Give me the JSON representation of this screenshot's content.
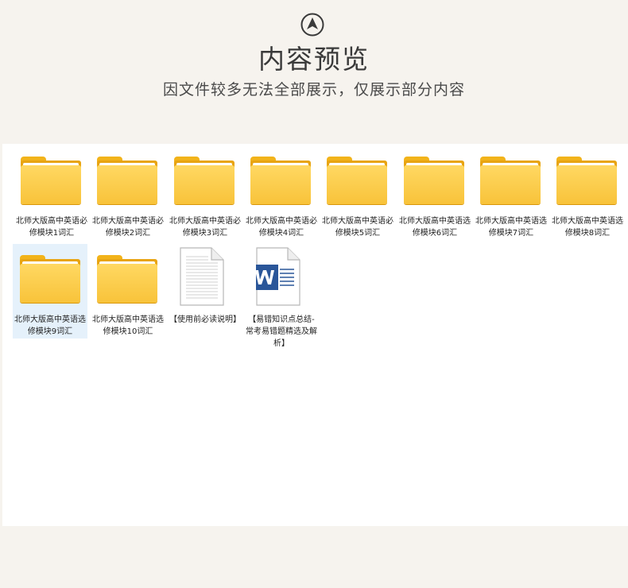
{
  "header": {
    "title": "内容预览",
    "subtitle": "因文件较多无法全部展示，仅展示部分内容"
  },
  "files": [
    {
      "name": "北师大版高中英语必修模块1词汇",
      "type": "folder"
    },
    {
      "name": "北师大版高中英语必修模块2词汇",
      "type": "folder"
    },
    {
      "name": "北师大版高中英语必修模块3词汇",
      "type": "folder"
    },
    {
      "name": "北师大版高中英语必修模块4词汇",
      "type": "folder"
    },
    {
      "name": "北师大版高中英语必修模块5词汇",
      "type": "folder"
    },
    {
      "name": "北师大版高中英语选修模块6词汇",
      "type": "folder"
    },
    {
      "name": "北师大版高中英语选修模块7词汇",
      "type": "folder"
    },
    {
      "name": "北师大版高中英语选修模块8词汇",
      "type": "folder"
    },
    {
      "name": "北师大版高中英语选修模块9词汇",
      "type": "folder",
      "selected": true
    },
    {
      "name": "北师大版高中英语选修模块10词汇",
      "type": "folder"
    },
    {
      "name": "【使用前必读说明】",
      "type": "text-document"
    },
    {
      "name": "【易错知识点总结-常考易错题精选及解析】",
      "type": "word-document"
    }
  ],
  "colors": {
    "background": "#f6f3ee",
    "panel": "#ffffff",
    "folder": "#f8c33a",
    "selection": "#e5f1fb",
    "word_blue": "#2a5699"
  },
  "icons": {
    "logo": "up-arrow-circle-icon",
    "folder": "folder-icon",
    "text_document": "text-document-icon",
    "word_document": "word-document-icon"
  }
}
